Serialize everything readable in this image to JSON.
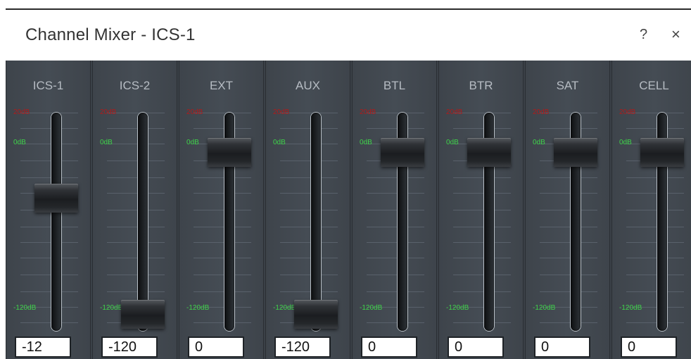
{
  "window": {
    "title": "Channel Mixer - ICS-1",
    "help_label": "?",
    "close_label": "×"
  },
  "scale": {
    "max_label": "20dB",
    "zero_label": "0dB",
    "min_label": "-120dB",
    "min_db": -120,
    "max_db": 20
  },
  "channels": [
    {
      "name": "ICS-1",
      "value": "-12",
      "db": -12
    },
    {
      "name": "ICS-2",
      "value": "-120",
      "db": -120
    },
    {
      "name": "EXT",
      "value": "0",
      "db": 0
    },
    {
      "name": "AUX",
      "value": "-120",
      "db": -120
    },
    {
      "name": "BTL",
      "value": "0",
      "db": 0
    },
    {
      "name": "BTR",
      "value": "0",
      "db": 0
    },
    {
      "name": "SAT",
      "value": "0",
      "db": 0
    },
    {
      "name": "CELL",
      "value": "0",
      "db": 0
    }
  ],
  "colors": {
    "panel": "#3b4148",
    "max_mark": "#b01a1a",
    "level_mark": "#3fd34a"
  }
}
